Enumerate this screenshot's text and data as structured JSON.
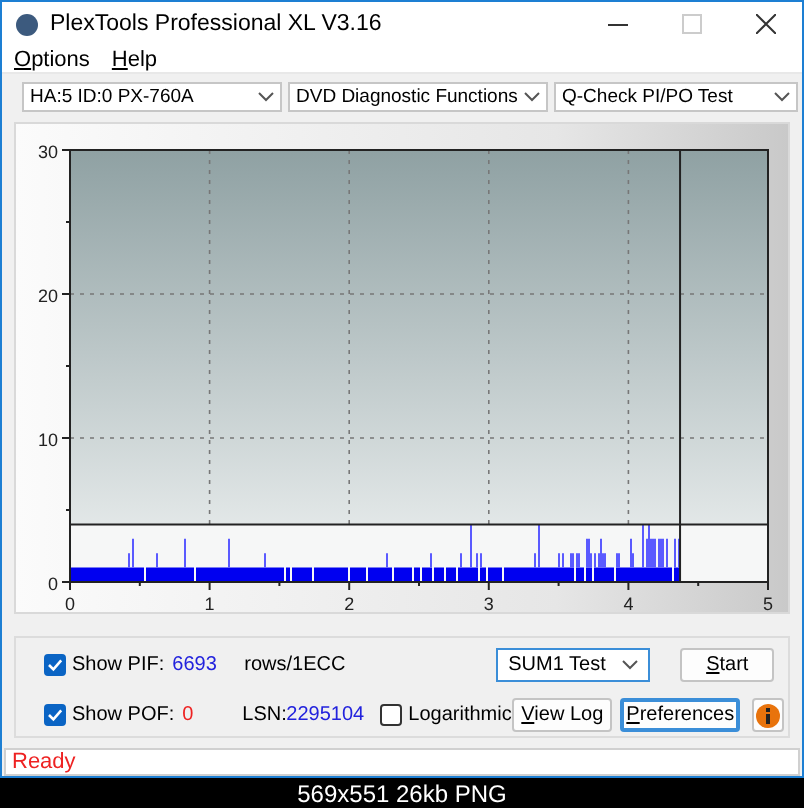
{
  "window": {
    "title": "PlexTools Professional XL V3.16"
  },
  "menu": [
    {
      "label": "Options"
    },
    {
      "label": "Help"
    }
  ],
  "selectors": [
    {
      "value": "HA:5 ID:0  PX-760A"
    },
    {
      "value": "DVD Diagnostic Functions"
    },
    {
      "value": "Q-Check PI/PO Test"
    }
  ],
  "chart": {
    "y_ticks": [
      "30",
      "20",
      "10",
      "0"
    ],
    "x_ticks": [
      "0",
      "1",
      "2",
      "3",
      "4",
      "5"
    ]
  },
  "controls": {
    "show_pif": {
      "label": "Show PIF:",
      "checked": true,
      "value": "6693"
    },
    "unit": "rows/1ECC",
    "test_select": "SUM1 Test",
    "show_pof": {
      "label": "Show POF:",
      "checked": true,
      "value": "0"
    },
    "lsn_label": "LSN:",
    "lsn": "2295104",
    "logarithmic": {
      "label": "Logarithmic",
      "checked": false
    },
    "buttons": [
      {
        "label": "Start",
        "focused": false
      },
      {
        "label": "View Log",
        "focused": false
      },
      {
        "label": "Preferences",
        "focused": true
      }
    ]
  },
  "status": "Ready",
  "caption": "569x551 26kb PNG"
}
